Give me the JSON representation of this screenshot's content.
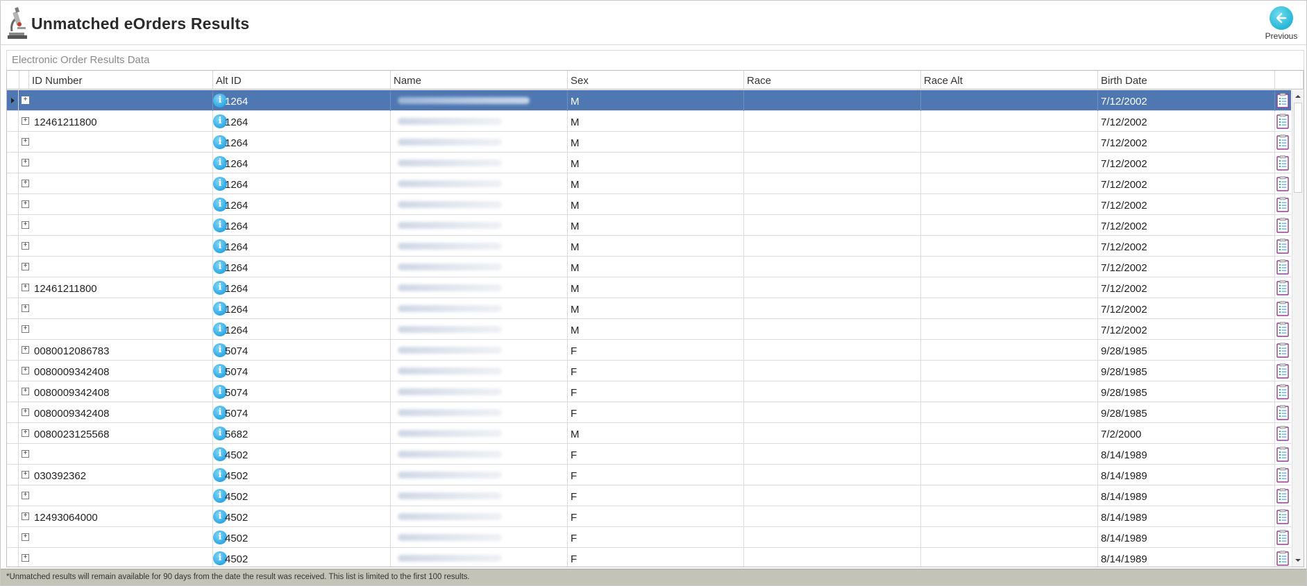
{
  "app": {
    "title": "Unmatched eOrders Results",
    "icon": "microscope-icon"
  },
  "toolbar": {
    "previous_label": "Previous",
    "previous_icon": "arrow-left-icon"
  },
  "section": {
    "title": "Electronic Order Results Data"
  },
  "grid": {
    "columns": [
      "ID Number",
      "Alt ID",
      "Name",
      "Sex",
      "Race",
      "Race Alt",
      "Birth Date"
    ],
    "rows": [
      {
        "id": "",
        "alt": "1264",
        "sex": "M",
        "race": "",
        "race_alt": "",
        "dob": "7/12/2002",
        "selected": true
      },
      {
        "id": "12461211800",
        "alt": "1264",
        "sex": "M",
        "race": "",
        "race_alt": "",
        "dob": "7/12/2002"
      },
      {
        "id": "",
        "alt": "1264",
        "sex": "M",
        "race": "",
        "race_alt": "",
        "dob": "7/12/2002"
      },
      {
        "id": "",
        "alt": "1264",
        "sex": "M",
        "race": "",
        "race_alt": "",
        "dob": "7/12/2002"
      },
      {
        "id": "",
        "alt": "1264",
        "sex": "M",
        "race": "",
        "race_alt": "",
        "dob": "7/12/2002"
      },
      {
        "id": "",
        "alt": "1264",
        "sex": "M",
        "race": "",
        "race_alt": "",
        "dob": "7/12/2002"
      },
      {
        "id": "",
        "alt": "1264",
        "sex": "M",
        "race": "",
        "race_alt": "",
        "dob": "7/12/2002"
      },
      {
        "id": "",
        "alt": "1264",
        "sex": "M",
        "race": "",
        "race_alt": "",
        "dob": "7/12/2002"
      },
      {
        "id": "",
        "alt": "1264",
        "sex": "M",
        "race": "",
        "race_alt": "",
        "dob": "7/12/2002"
      },
      {
        "id": "12461211800",
        "alt": "1264",
        "sex": "M",
        "race": "",
        "race_alt": "",
        "dob": "7/12/2002"
      },
      {
        "id": "",
        "alt": "1264",
        "sex": "M",
        "race": "",
        "race_alt": "",
        "dob": "7/12/2002"
      },
      {
        "id": "",
        "alt": "1264",
        "sex": "M",
        "race": "",
        "race_alt": "",
        "dob": "7/12/2002"
      },
      {
        "id": "0080012086783",
        "alt": "5074",
        "sex": "F",
        "race": "",
        "race_alt": "",
        "dob": "9/28/1985"
      },
      {
        "id": "0080009342408",
        "alt": "5074",
        "sex": "F",
        "race": "",
        "race_alt": "",
        "dob": "9/28/1985"
      },
      {
        "id": "0080009342408",
        "alt": "5074",
        "sex": "F",
        "race": "",
        "race_alt": "",
        "dob": "9/28/1985"
      },
      {
        "id": "0080009342408",
        "alt": "5074",
        "sex": "F",
        "race": "",
        "race_alt": "",
        "dob": "9/28/1985"
      },
      {
        "id": "0080023125568",
        "alt": "5682",
        "sex": "M",
        "race": "",
        "race_alt": "",
        "dob": "7/2/2000"
      },
      {
        "id": "",
        "alt": "4502",
        "sex": "F",
        "race": "",
        "race_alt": "",
        "dob": "8/14/1989"
      },
      {
        "id": "030392362",
        "alt": "4502",
        "sex": "F",
        "race": "",
        "race_alt": "",
        "dob": "8/14/1989"
      },
      {
        "id": "",
        "alt": "4502",
        "sex": "F",
        "race": "",
        "race_alt": "",
        "dob": "8/14/1989"
      },
      {
        "id": "12493064000",
        "alt": "4502",
        "sex": "F",
        "race": "",
        "race_alt": "",
        "dob": "8/14/1989"
      },
      {
        "id": "",
        "alt": "4502",
        "sex": "F",
        "race": "",
        "race_alt": "",
        "dob": "8/14/1989"
      },
      {
        "id": "",
        "alt": "4502",
        "sex": "F",
        "race": "",
        "race_alt": "",
        "dob": "8/14/1989"
      }
    ]
  },
  "footer": {
    "note": "*Unmatched results will remain available for 90 days from the date the result was received. This list is limited to the first 100 results."
  },
  "colors": {
    "selected_row": "#4f78b2",
    "accent": "#27b6d6",
    "footer_bg": "#c4c3b8"
  }
}
